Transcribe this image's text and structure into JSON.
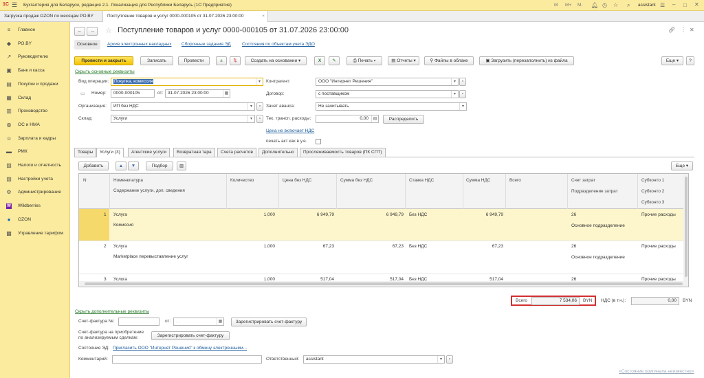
{
  "titlebar": {
    "title": "Бухгалтерия для Беларуси, редакция 2.1. Локализация для Республики Беларусь  (1С:Предприятие)",
    "icons": [
      "M",
      "M+",
      "M-",
      "bell-icon",
      "history-icon",
      "star-icon",
      "search-icon"
    ],
    "user": "assistant"
  },
  "tabs": [
    {
      "label": "Загрузка продаж OZON по месяцам РО.BY"
    },
    {
      "label": "Поступление товаров и услуг 0000-000105 от 31.07.2026 23:00:00"
    }
  ],
  "sidebar": {
    "items": [
      {
        "label": "Главное",
        "icon": "≡"
      },
      {
        "label": "РО.BY",
        "icon": "◆"
      },
      {
        "label": "Руководителю",
        "icon": "↗"
      },
      {
        "label": "Банк и касса",
        "icon": "▣"
      },
      {
        "label": "Покупки и продажи",
        "icon": "▤"
      },
      {
        "label": "Склад",
        "icon": "▦"
      },
      {
        "label": "Производство",
        "icon": "▥"
      },
      {
        "label": "ОС и НМА",
        "icon": "◍"
      },
      {
        "label": "Зарплата и кадры",
        "icon": "☺"
      },
      {
        "label": "РМК",
        "icon": "▬"
      },
      {
        "label": "Налоги и отчетность",
        "icon": "▧"
      },
      {
        "label": "Настройки учета",
        "icon": "▨"
      },
      {
        "label": "Администрирование",
        "icon": "⚙"
      },
      {
        "label": "Wildberries",
        "icon": "W"
      },
      {
        "label": "OZON",
        "icon": "●"
      },
      {
        "label": "Управление тарифом",
        "icon": "▩"
      }
    ]
  },
  "doc": {
    "title": "Поступление товаров и услуг 0000-000105 от 31.07.2026 23:00:00",
    "nav_links": [
      "Основное",
      "Архив электронных накладных",
      "Сборочные задания ЭД",
      "Состояния по объектам учета ЭДО"
    ],
    "toolbar": {
      "post_close": "Провести и закрыть",
      "save": "Записать",
      "post": "Провести",
      "create_based": "Создать на основании",
      "print": "Печать",
      "reports": "Отчеты",
      "cloud_files": "Файлы в облаке",
      "load_file": "Загрузить (перезаполнить) из файла",
      "more": "Еще"
    },
    "hide_main": "Скрыть основные реквизиты",
    "fields": {
      "op_type_label": "Вид операции:",
      "op_type": "Покупка, комиссия",
      "number_label": "Номер:",
      "number": "0000-000105",
      "date_label": "от:",
      "date": "31.07.2026 23:00:00",
      "org_label": "Организация:",
      "org": "ИП без НДС",
      "warehouse_label": "Склад:",
      "warehouse": "Услуги",
      "counterparty_label": "Контрагент:",
      "counterparty": "ООО \"Интернет Решения\"",
      "contract_label": "Договор:",
      "contract": "с поставщиком",
      "advance_label": "Зачет аванса:",
      "advance": "Не зачитывать",
      "transport_label": "Тек. трансп. расходы:",
      "transport": "0,00",
      "distribute": "Распределить",
      "price_no_vat": "Цена не включает НДС",
      "print_act": "печать акт как в у.е."
    },
    "form_tabs": [
      "Товары",
      "Услуги (3)",
      "Агентские услуги",
      "Возвратная тара",
      "Счета расчетов",
      "Дополнительно",
      "Прослеживаемость товаров (ПК СПТ)"
    ],
    "table_toolbar": {
      "add": "Добавить",
      "select": "Подбор",
      "more": "Еще"
    },
    "columns": {
      "n": "N",
      "nomen": "Номенклатура",
      "content": "Содержание услуги, доп. сведения",
      "qty": "Количество",
      "price": "Цена без НДС",
      "sum": "Сумма без НДС",
      "rate": "Ставка НДС",
      "vat": "Сумма НДС",
      "total": "Всего",
      "acc": "Счет затрат",
      "dept": "Подразделение затрат",
      "sub1": "Субконто 1",
      "sub2": "Субконто 2",
      "sub3": "Субконто 3"
    },
    "rows": [
      {
        "n": "1",
        "nomen": "Услуга",
        "content": "Комиссия",
        "qty": "1,000",
        "price": "6 949,79",
        "sum": "6 949,79",
        "rate": "Без НДС",
        "vat": "",
        "total": "6 949,79",
        "acc": "26",
        "dept": "Основное подразделение",
        "sub1": "Прочие расходы"
      },
      {
        "n": "2",
        "nomen": "Услуга",
        "content": "Marketplace перевыставление услуг",
        "qty": "1,000",
        "price": "67,23",
        "sum": "67,23",
        "rate": "Без НДС",
        "vat": "",
        "total": "67,23",
        "acc": "26",
        "dept": "Основное подразделение",
        "sub1": "Прочие расходы"
      },
      {
        "n": "3",
        "nomen": "Услуга",
        "content": "",
        "qty": "1,000",
        "price": "517,04",
        "sum": "517,04",
        "rate": "Без НДС",
        "vat": "",
        "total": "517,04",
        "acc": "26",
        "dept": "",
        "sub1": "Прочие расходы"
      }
    ],
    "totals": {
      "total_label": "Всего",
      "total": "7 534,06",
      "currency": "BYN",
      "vat_label": "НДС (в т.ч.):",
      "vat": "0,00",
      "vat_currency": "BYN"
    },
    "hide_extra": "Скрыть дополнительные реквизиты",
    "invoice_label": "Счет-фактура №:",
    "invoice_date_label": "от:",
    "invoice_date": " .  .",
    "register_invoice": "Зарегистрировать счет-фактуру",
    "acq_invoice_label": "Счет-фактура на приобретение по анализируемым сделкам:",
    "register_invoice2": "Зарегистрировать счет-фактуру",
    "ed_state_label": "Состояние ЭД:",
    "ed_state_link": "Пригласить ООО \"Интернет Решения\" к обмену электронными...",
    "comment_label": "Комментарий:",
    "responsible_label": "Ответственный:",
    "responsible": "assistant",
    "original_state": "<Состояние оригинала неизвестно>"
  },
  "colors": {
    "accent_yellow": "#fbeb9e",
    "button_yellow": "#f5c400",
    "link": "#1c5c9c",
    "green_link": "#2e7d32",
    "total_border": "#d32f2f"
  }
}
